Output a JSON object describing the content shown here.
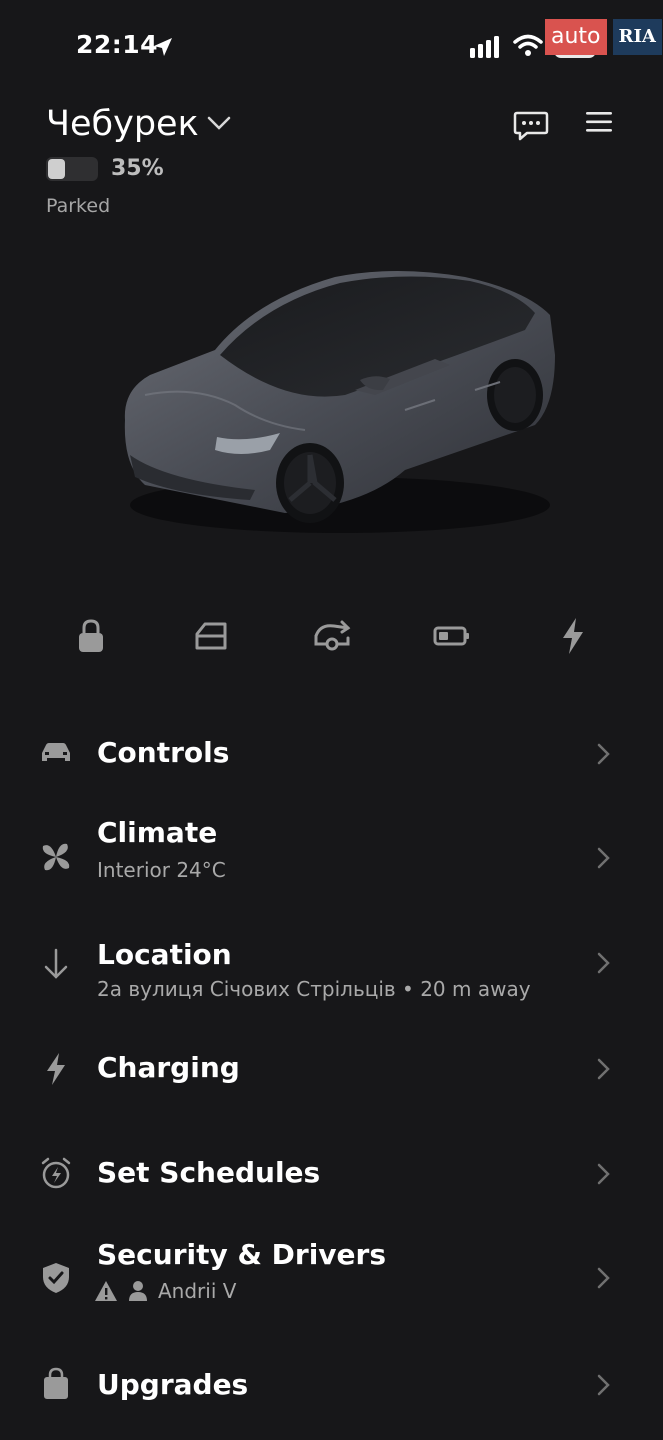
{
  "status_bar": {
    "time": "22:14",
    "battery": "80"
  },
  "watermark": {
    "left": "auto",
    "right": "RIA"
  },
  "header": {
    "car_name": "Чебурек",
    "battery_percent": "35%",
    "battery_level": 0.35,
    "status": "Parked"
  },
  "quick_actions": [
    "lock-icon",
    "frunk-icon",
    "trunk-icon",
    "battery-icon",
    "charge-icon"
  ],
  "menu": {
    "controls": {
      "title": "Controls"
    },
    "climate": {
      "title": "Climate",
      "subtitle": "Interior 24°C"
    },
    "location": {
      "title": "Location",
      "subtitle": "2а вулиця Січових Стрільців • 20 m away"
    },
    "charging": {
      "title": "Charging"
    },
    "schedules": {
      "title": "Set Schedules"
    },
    "security": {
      "title": "Security & Drivers",
      "driver": "Andrii V"
    },
    "upgrades": {
      "title": "Upgrades"
    }
  },
  "colors": {
    "background": "#171719",
    "text": "#f2f2f2",
    "muted": "#a9a9a9",
    "icon": "#9a9a9a"
  }
}
